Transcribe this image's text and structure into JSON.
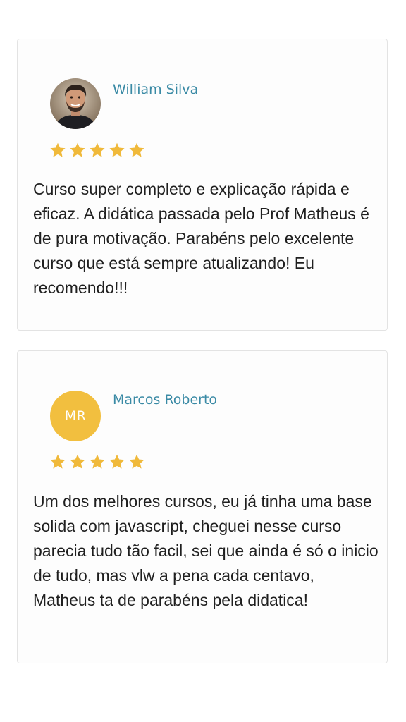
{
  "reviews": [
    {
      "name": "William Silva",
      "avatar": {
        "type": "photo",
        "icon": "user-photo-icon"
      },
      "rating": 5,
      "max_rating": 5,
      "text": "Curso super completo e explicação rápida e eficaz. A didática passada pelo Prof Matheus é de pura motivação. Parabéns pelo excelente curso que está sempre atualizando! Eu recomendo!!!"
    },
    {
      "name": "Marcos Roberto",
      "avatar": {
        "type": "initials",
        "initials": "MR",
        "color": "#f2bf3f"
      },
      "rating": 5,
      "max_rating": 5,
      "text": "Um dos melhores cursos, eu já tinha uma base solida com javascript, cheguei nesse curso parecia tudo tão facil, sei que ainda é só o inicio de tudo, mas vlw a pena cada centavo, Matheus ta de parabéns pela didatica!"
    }
  ],
  "colors": {
    "name": "#3a8aa5",
    "star": "#f0b93a",
    "text": "#1f1f1f",
    "card_border": "#e3e3e3"
  }
}
